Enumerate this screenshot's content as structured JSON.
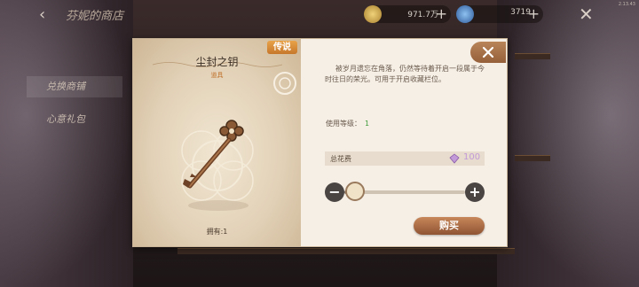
{
  "version": "2.13.43",
  "header": {
    "shop_title": "芬妮的商店",
    "currencies": [
      {
        "name": "gold-coin",
        "amount": "971.7万",
        "color": "#c8a24a"
      },
      {
        "name": "blue-gem",
        "amount": "3719",
        "color": "#4a7cc0"
      }
    ]
  },
  "sidebar": {
    "tabs": [
      {
        "label": "兑换商铺",
        "active": true
      },
      {
        "label": "心意礼包",
        "active": false
      }
    ]
  },
  "item_popup": {
    "rarity_badge": "传说",
    "name": "尘封之钥",
    "category": "道具",
    "owned_text": "拥有:1",
    "description": "被岁月遗忘在角落，仍然等待着开启一段属于今时往日的荣光。可用于开启收藏栏位。",
    "use_level_label": "使用等级：",
    "use_level_value": "1",
    "total_cost_label": "总花费",
    "total_cost_value": "100",
    "quantity_slider_fraction": 0.0,
    "buy_label": "购买",
    "accent_color": "#c7782b",
    "cost_color": "#c29ad8",
    "level_color": "#3f9a3a"
  }
}
